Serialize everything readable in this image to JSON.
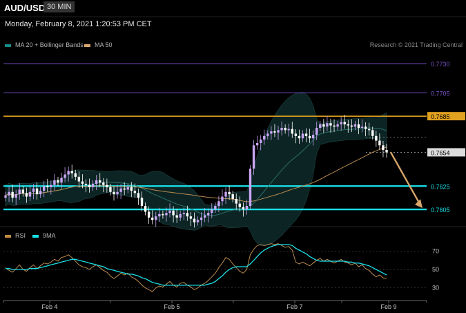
{
  "header": {
    "symbol": "AUD/USD",
    "timeframe": "30 MIN",
    "datetime": "Monday, February 8, 2021 1:20:53 PM CET"
  },
  "legend_main": [
    {
      "label": "MA 20 + Bollinger Bands",
      "color": "#1a8a8a"
    },
    {
      "label": "MA 50",
      "color": "#d9a66b"
    }
  ],
  "legend_rsi": [
    {
      "label": "RSI",
      "color": "#c08a40"
    },
    {
      "label": "9MA",
      "color": "#19e0e8"
    }
  ],
  "credit": "Research © 2021 Trading Central",
  "colors": {
    "background": "#000000",
    "up_candle": "#c9a6f5",
    "down_candle": "#ffffff",
    "bands_fill": "#0e2a28",
    "ma50": "#b88a50",
    "ma20": "#2a6e6a",
    "support": "#19e0e8",
    "resistance_major": "#e0a020",
    "resistance_minor": "#7a52c8",
    "arrow": "#d9a66b"
  },
  "chart_data": [
    {
      "type": "candlestick",
      "title": "",
      "x_ticks": [
        "Feb 4",
        "Feb 5",
        "Feb 7",
        "Feb 9"
      ],
      "y_range": [
        0.7592,
        0.7742
      ],
      "price_levels": [
        {
          "value": "0.7730",
          "kind": "resistance-minor"
        },
        {
          "value": "0.7705",
          "kind": "resistance-minor"
        },
        {
          "value": "0.7685",
          "kind": "resistance-major"
        },
        {
          "value": "0.7654",
          "kind": "current"
        },
        {
          "value": "0.7625",
          "kind": "support"
        },
        {
          "value": "0.7605",
          "kind": "support"
        }
      ],
      "projection": {
        "from": 0.7654,
        "to": 0.7605
      },
      "close_series": [
        0.7617,
        0.762,
        0.7615,
        0.7618,
        0.7622,
        0.7619,
        0.7616,
        0.762,
        0.7623,
        0.7618,
        0.7621,
        0.7625,
        0.7624,
        0.7626,
        0.763,
        0.7628,
        0.7632,
        0.7635,
        0.7638,
        0.7636,
        0.7633,
        0.7629,
        0.7627,
        0.7626,
        0.7624,
        0.7627,
        0.763,
        0.7628,
        0.7626,
        0.7624,
        0.762,
        0.7618,
        0.762,
        0.7623,
        0.7622,
        0.7624,
        0.7621,
        0.7619,
        0.7615,
        0.7608,
        0.7603,
        0.7598,
        0.7596,
        0.7599,
        0.7601,
        0.76,
        0.7602,
        0.7604,
        0.76,
        0.7598,
        0.7601,
        0.7602,
        0.7599,
        0.7597,
        0.7594,
        0.7596,
        0.7598,
        0.76,
        0.7602,
        0.7605,
        0.7608,
        0.7612,
        0.7616,
        0.762,
        0.7618,
        0.7614,
        0.761,
        0.7607,
        0.7605,
        0.7608,
        0.764,
        0.766,
        0.7662,
        0.7665,
        0.7668,
        0.767,
        0.7672,
        0.7671,
        0.7673,
        0.7675,
        0.7673,
        0.7674,
        0.767,
        0.7668,
        0.7666,
        0.767,
        0.7668,
        0.7666,
        0.7669,
        0.7675,
        0.7678,
        0.7676,
        0.7679,
        0.7677,
        0.7676,
        0.7678,
        0.768,
        0.7678,
        0.7677,
        0.7676,
        0.7678,
        0.7675,
        0.7676,
        0.7674,
        0.7673,
        0.7668,
        0.7664,
        0.766,
        0.7656,
        0.7654
      ]
    },
    {
      "type": "line",
      "title": "",
      "y_ticks": [
        "70",
        "50",
        "30"
      ],
      "y_range": [
        20,
        80
      ],
      "series": [
        {
          "name": "RSI",
          "values": [
            52,
            49,
            47,
            51,
            55,
            50,
            48,
            52,
            55,
            51,
            54,
            57,
            56,
            58,
            61,
            59,
            63,
            64,
            66,
            63,
            59,
            55,
            53,
            52,
            50,
            53,
            55,
            52,
            49,
            47,
            43,
            40,
            43,
            46,
            44,
            46,
            42,
            40,
            37,
            33,
            30,
            28,
            26,
            30,
            32,
            31,
            34,
            37,
            33,
            31,
            35,
            36,
            33,
            31,
            28,
            30,
            33,
            35,
            38,
            42,
            46,
            52,
            57,
            63,
            61,
            56,
            52,
            48,
            46,
            50,
            66,
            72,
            76,
            77,
            76,
            77,
            78,
            77,
            78,
            76,
            74,
            75,
            71,
            58,
            56,
            58,
            56,
            54,
            57,
            60,
            62,
            59,
            61,
            59,
            57,
            59,
            61,
            58,
            57,
            55,
            57,
            53,
            55,
            51,
            49,
            45,
            42,
            44,
            41,
            40
          ]
        },
        {
          "name": "9MA",
          "values": [
            51,
            51,
            50,
            50,
            50,
            50,
            50,
            51,
            51,
            51,
            52,
            53,
            54,
            55,
            56,
            57,
            58,
            59,
            60,
            61,
            61,
            60,
            59,
            58,
            57,
            56,
            55,
            54,
            53,
            51,
            50,
            49,
            48,
            47,
            46,
            45,
            45,
            44,
            43,
            41,
            40,
            38,
            36,
            35,
            34,
            33,
            33,
            33,
            33,
            33,
            33,
            33,
            33,
            33,
            33,
            33,
            33,
            33,
            34,
            35,
            37,
            40,
            43,
            47,
            50,
            52,
            53,
            53,
            53,
            53,
            56,
            60,
            64,
            68,
            71,
            73,
            75,
            76,
            77,
            77,
            77,
            77,
            76,
            73,
            71,
            69,
            67,
            64,
            62,
            60,
            59,
            59,
            59,
            59,
            59,
            59,
            59,
            59,
            58,
            58,
            57,
            57,
            56,
            55,
            54,
            52,
            50,
            48,
            46,
            44
          ]
        }
      ]
    }
  ]
}
